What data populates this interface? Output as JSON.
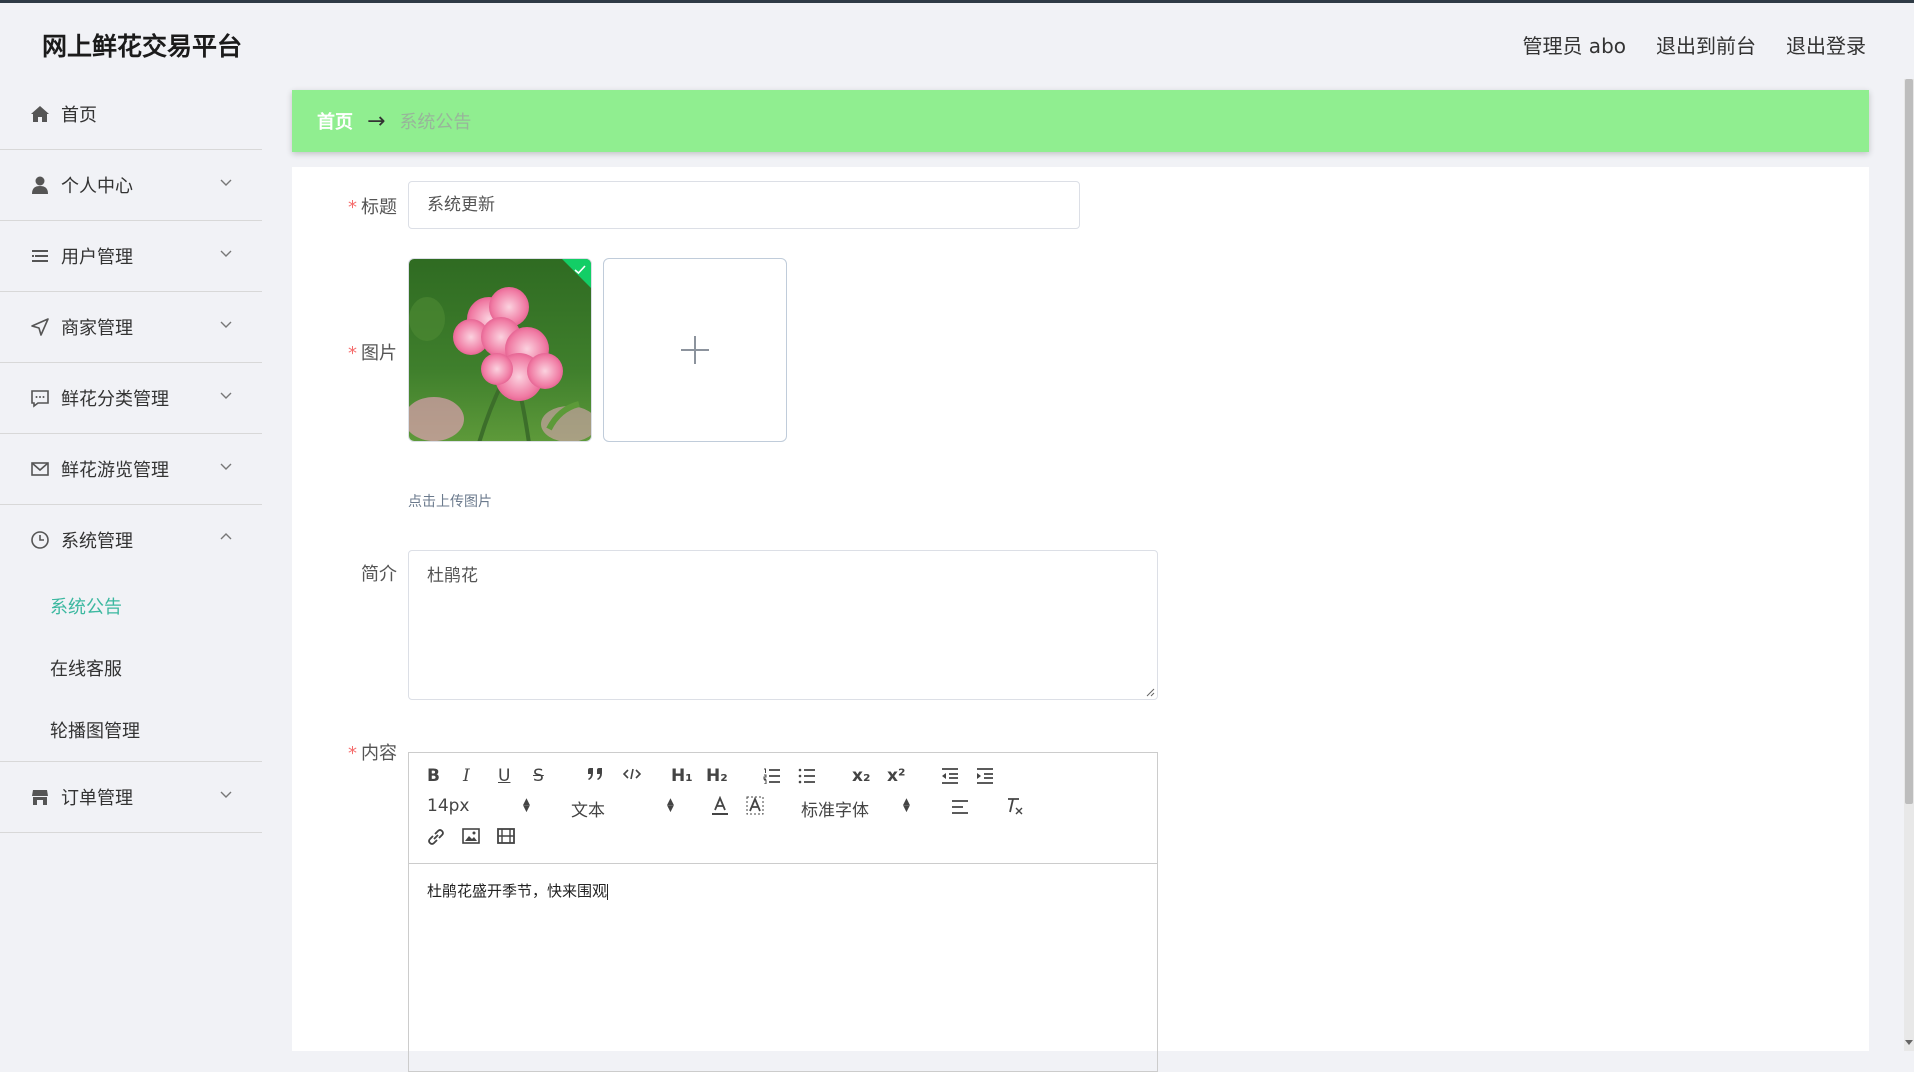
{
  "header": {
    "brand": "网上鲜花交易平台",
    "admin_label": "管理员 abo",
    "front_label": "退出到前台",
    "logout_label": "退出登录"
  },
  "sidebar": {
    "items": [
      {
        "label": "首页",
        "icon": "home-icon"
      },
      {
        "label": "个人中心",
        "icon": "user-icon"
      },
      {
        "label": "用户管理",
        "icon": "list-icon"
      },
      {
        "label": "商家管理",
        "icon": "navigation-icon"
      },
      {
        "label": "鲜花分类管理",
        "icon": "message-icon"
      },
      {
        "label": "鲜花游览管理",
        "icon": "mail-icon"
      },
      {
        "label": "系统管理",
        "icon": "clock-icon"
      },
      {
        "label": "订单管理",
        "icon": "shop-icon"
      }
    ],
    "system_sub": [
      "系统公告",
      "在线客服",
      "轮播图管理"
    ]
  },
  "breadcrumb": {
    "home": "首页",
    "arrow": "→",
    "current": "系统公告"
  },
  "form": {
    "title_label": "标题",
    "title_value": "系统更新",
    "image_label": "图片",
    "upload_tip": "点击上传图片",
    "intro_label": "简介",
    "intro_value": "杜鹃花",
    "content_label": "内容",
    "content_value": "杜鹃花盛开季节，快来围观",
    "required_mark": "*"
  },
  "editor": {
    "font_size": "14px",
    "header_select": "文本",
    "font_family": "标准字体",
    "bold": "B",
    "italic": "I",
    "underline": "U",
    "strike": "S",
    "h1": "H₁",
    "h2": "H₂",
    "sub": "x₂",
    "sup": "x²",
    "clean": "Tx"
  },
  "colors": {
    "breadcrumb_bg": "#90ee90",
    "active_menu": "#3cb8a0",
    "required": "#f56c6c"
  }
}
